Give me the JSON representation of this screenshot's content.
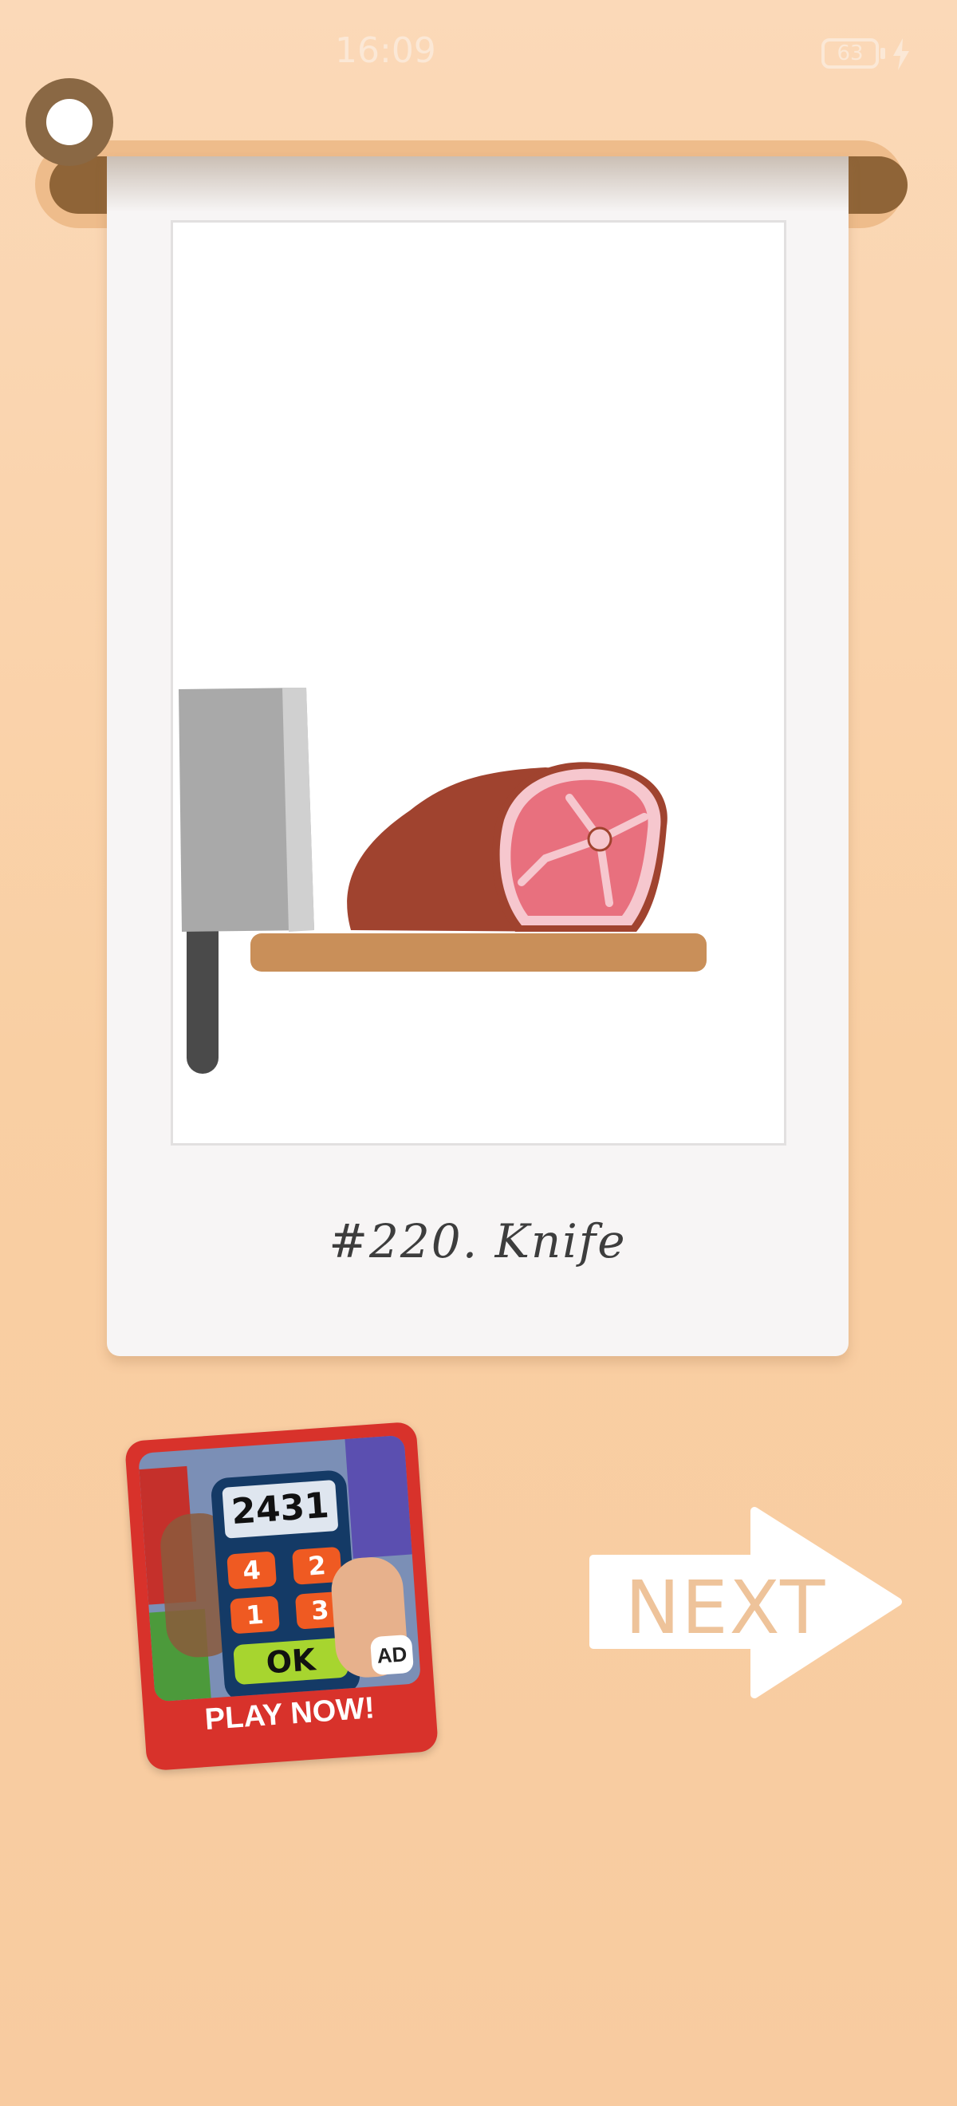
{
  "status_bar": {
    "time": "16:09",
    "battery": "63",
    "charging_icon": "lightning-bolt"
  },
  "card": {
    "caption": "#220. Knife",
    "illustration": {
      "objects": [
        "cleaver",
        "meat",
        "cutting-board"
      ]
    }
  },
  "ad": {
    "display_number": "2431",
    "keys": [
      "4",
      "2",
      "1",
      "3"
    ],
    "ok_label": "OK",
    "badge": "AD",
    "cta": "PLAY NOW!"
  },
  "next_button": {
    "label": "NEXT",
    "icon": "arrow-right"
  },
  "colors": {
    "background": "#f9cfa3",
    "card": "#f7f5f5",
    "rod": "#8f6437",
    "meat_dark": "#a0432f",
    "meat_light": "#e8707e",
    "board": "#c98f59",
    "next_text": "#eec39a",
    "ad_red": "#d8322b"
  }
}
